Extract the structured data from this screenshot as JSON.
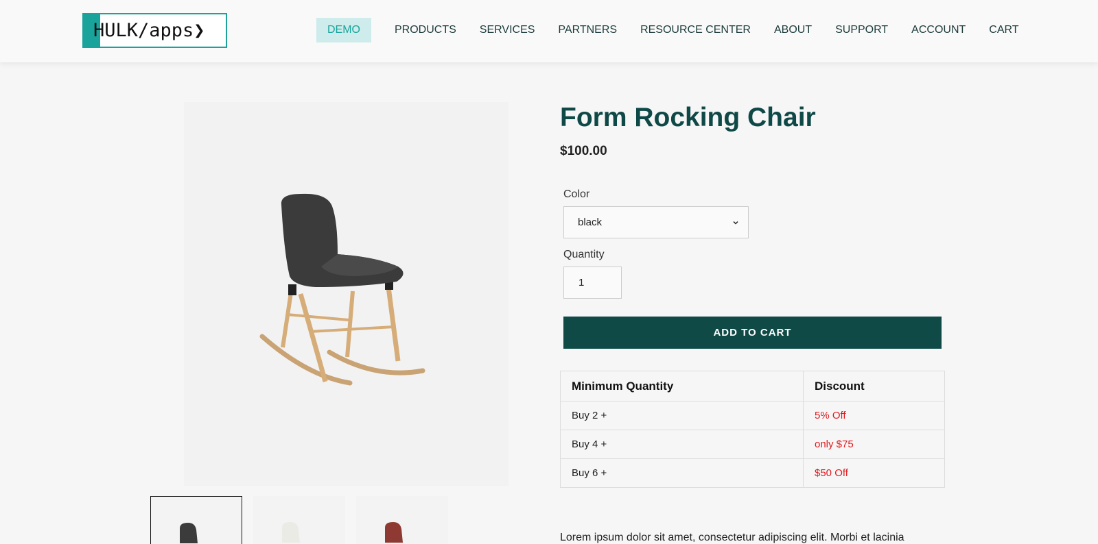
{
  "header": {
    "logo": "HULK/apps❯",
    "nav": [
      "DEMO",
      "PRODUCTS",
      "SERVICES",
      "PARTNERS",
      "RESOURCE CENTER",
      "ABOUT",
      "SUPPORT",
      "ACCOUNT",
      "CART"
    ]
  },
  "product": {
    "title": "Form Rocking Chair",
    "price": "$100.00",
    "color_label": "Color",
    "color_value": "black",
    "quantity_label": "Quantity",
    "quantity_value": "1",
    "add_to_cart": "ADD TO CART",
    "description": "Lorem ipsum dolor sit amet, consectetur adipiscing elit. Morbi et lacinia"
  },
  "discount_table": {
    "headers": [
      "Minimum Quantity",
      "Discount"
    ],
    "rows": [
      [
        "Buy 2 +",
        "5% Off"
      ],
      [
        "Buy 4 +",
        "only $75"
      ],
      [
        "Buy 6 +",
        "$50 Off"
      ]
    ]
  },
  "thumbnails": [
    "black",
    "white",
    "red"
  ],
  "colors": {
    "accent": "#19a39b",
    "button": "#0f4a47",
    "discount_text": "#e0191e"
  }
}
